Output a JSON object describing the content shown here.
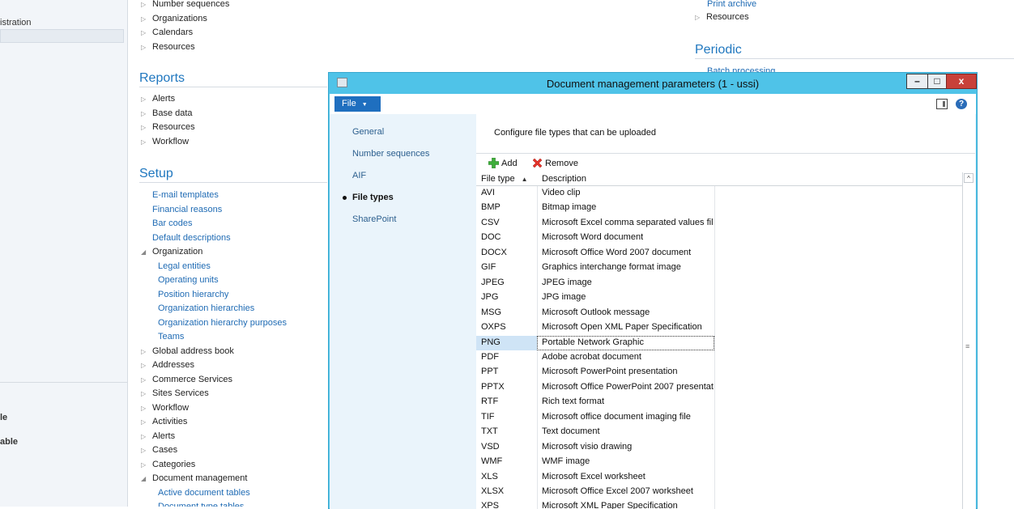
{
  "left_nav": {
    "items": [
      {
        "label": "istration"
      },
      {
        "label": "le"
      },
      {
        "label": "able"
      }
    ]
  },
  "main": {
    "top_items": [
      "Number sequences",
      "Organizations",
      "Calendars",
      "Resources"
    ],
    "reports_title": "Reports",
    "reports_items": [
      "Alerts",
      "Base data",
      "Resources",
      "Workflow"
    ],
    "setup_title": "Setup",
    "setup_items": [
      {
        "label": "E-mail templates",
        "kind": "link"
      },
      {
        "label": "Financial reasons",
        "kind": "link"
      },
      {
        "label": "Bar codes",
        "kind": "link"
      },
      {
        "label": "Default descriptions",
        "kind": "link"
      },
      {
        "label": "Organization",
        "kind": "group-open"
      },
      {
        "label": "Legal entities",
        "kind": "sublink"
      },
      {
        "label": "Operating units",
        "kind": "sublink"
      },
      {
        "label": "Position hierarchy",
        "kind": "sublink"
      },
      {
        "label": "Organization hierarchies",
        "kind": "sublink"
      },
      {
        "label": "Organization hierarchy purposes",
        "kind": "sublink"
      },
      {
        "label": "Teams",
        "kind": "sublink"
      },
      {
        "label": "Global address book",
        "kind": "group"
      },
      {
        "label": "Addresses",
        "kind": "group"
      },
      {
        "label": "Commerce Services",
        "kind": "group"
      },
      {
        "label": "Sites Services",
        "kind": "group"
      },
      {
        "label": "Workflow",
        "kind": "group"
      },
      {
        "label": "Activities",
        "kind": "group"
      },
      {
        "label": "Alerts",
        "kind": "group"
      },
      {
        "label": "Cases",
        "kind": "group"
      },
      {
        "label": "Categories",
        "kind": "group"
      },
      {
        "label": "Document management",
        "kind": "group-open"
      },
      {
        "label": "Active document tables",
        "kind": "sublink"
      },
      {
        "label": "Document type tables",
        "kind": "sublink"
      }
    ],
    "right_col": {
      "print_archive": "Print archive",
      "resources": "Resources",
      "periodic_title": "Periodic",
      "batch_processing": "Batch processing"
    }
  },
  "dialog": {
    "title": "Document management parameters (1 - ussi)",
    "file_menu_label": "File",
    "minimize": "–",
    "maximize": "□",
    "close": "x",
    "tabs": [
      {
        "label": "General",
        "active": false
      },
      {
        "label": "Number sequences",
        "active": false
      },
      {
        "label": "AIF",
        "active": false
      },
      {
        "label": "File types",
        "active": true
      },
      {
        "label": "SharePoint",
        "active": false
      }
    ],
    "description": "Configure file types that can be uploaded",
    "toolbar": {
      "add_label": "Add",
      "remove_label": "Remove"
    },
    "grid": {
      "columns": [
        "File type",
        "Description"
      ],
      "selected_index": 10,
      "rows": [
        {
          "type": "AVI",
          "description": "Video clip"
        },
        {
          "type": "BMP",
          "description": "Bitmap image"
        },
        {
          "type": "CSV",
          "description": "Microsoft Excel comma separated values file"
        },
        {
          "type": "DOC",
          "description": "Microsoft Word document"
        },
        {
          "type": "DOCX",
          "description": "Microsoft Office Word 2007 document"
        },
        {
          "type": "GIF",
          "description": "Graphics interchange format image"
        },
        {
          "type": "JPEG",
          "description": "JPEG image"
        },
        {
          "type": "JPG",
          "description": "JPG image"
        },
        {
          "type": "MSG",
          "description": "Microsoft Outlook message"
        },
        {
          "type": "OXPS",
          "description": "Microsoft Open XML Paper Specification"
        },
        {
          "type": "PNG",
          "description": "Portable Network Graphic"
        },
        {
          "type": "PDF",
          "description": "Adobe acrobat document"
        },
        {
          "type": "PPT",
          "description": "Microsoft PowerPoint presentation"
        },
        {
          "type": "PPTX",
          "description": "Microsoft Office PowerPoint 2007 presentat..."
        },
        {
          "type": "RTF",
          "description": "Rich text format"
        },
        {
          "type": "TIF",
          "description": "Microsoft office document imaging file"
        },
        {
          "type": "TXT",
          "description": "Text document"
        },
        {
          "type": "VSD",
          "description": "Microsoft visio drawing"
        },
        {
          "type": "WMF",
          "description": "WMF image"
        },
        {
          "type": "XLS",
          "description": "Microsoft Excel worksheet"
        },
        {
          "type": "XLSX",
          "description": "Microsoft Office Excel 2007 worksheet"
        },
        {
          "type": "XPS",
          "description": "Microsoft XML Paper Specification"
        }
      ]
    }
  },
  "colors": {
    "accent": "#1f6fbf",
    "dialog_frame": "#4fc3e8",
    "link": "#1f6bb4",
    "section_title": "#1f77bf",
    "close_button": "#c8413a",
    "selected_cell": "#cfe4f6"
  }
}
